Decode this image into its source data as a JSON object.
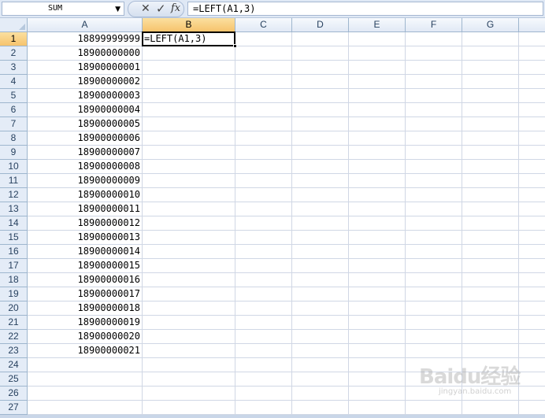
{
  "formula_bar": {
    "name_box": "SUM",
    "cancel_glyph": "✕",
    "enter_glyph": "✓",
    "fx_label": "fx",
    "formula": "=LEFT(A1,3)"
  },
  "columns": [
    "A",
    "B",
    "C",
    "D",
    "E",
    "F",
    "G"
  ],
  "rows": [
    "1",
    "2",
    "3",
    "4",
    "5",
    "6",
    "7",
    "8",
    "9",
    "10",
    "11",
    "12",
    "13",
    "14",
    "15",
    "16",
    "17",
    "18",
    "19",
    "20",
    "21",
    "22",
    "23",
    "24",
    "25",
    "26",
    "27"
  ],
  "column_a_values": [
    "18899999999",
    "18900000000",
    "18900000001",
    "18900000002",
    "18900000003",
    "18900000004",
    "18900000005",
    "18900000006",
    "18900000007",
    "18900000008",
    "18900000009",
    "18900000010",
    "18900000011",
    "18900000012",
    "18900000013",
    "18900000014",
    "18900000015",
    "18900000016",
    "18900000017",
    "18900000018",
    "18900000019",
    "18900000020",
    "18900000021"
  ],
  "active_cell": {
    "address": "B1",
    "content": "=LEFT(A1,3)"
  },
  "watermark": {
    "logo": "Baidu经验",
    "url": "jingyan.baidu.com"
  }
}
